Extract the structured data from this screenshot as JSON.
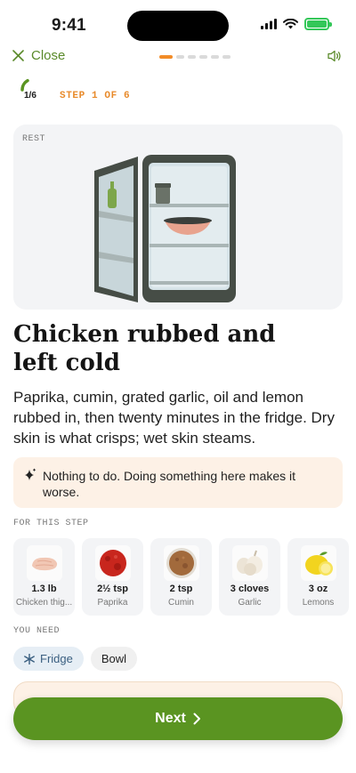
{
  "status": {
    "time": "9:41"
  },
  "nav": {
    "close_label": "Close",
    "dots_total": 6,
    "dots_active": 1
  },
  "step": {
    "count": "1/6",
    "label": "STEP 1 OF 6",
    "progress": 0.1667
  },
  "hero": {
    "tag": "REST",
    "illustration": "open-fridge-with-bowl"
  },
  "title_lines": [
    "Chicken rubbed and",
    "left cold"
  ],
  "description": "Paprika, cumin, grated garlic, oil and lemon rubbed in, then twenty minutes in the fridge. Dry skin is what crisps; wet skin steams.",
  "note": {
    "icon": "sparkle-icon",
    "text": "Nothing to do. Doing something here makes it worse."
  },
  "sections": {
    "ingredients": "FOR THIS STEP",
    "equipment": "YOU NEED"
  },
  "ingredients": [
    {
      "qty": "1.3 lb",
      "name": "Chicken thig...",
      "icon": "chicken-icon"
    },
    {
      "qty": "2½ tsp",
      "name": "Paprika",
      "icon": "paprika-icon"
    },
    {
      "qty": "2 tsp",
      "name": "Cumin",
      "icon": "cumin-icon"
    },
    {
      "qty": "3 cloves",
      "name": "Garlic",
      "icon": "garlic-icon"
    },
    {
      "qty": "3 oz",
      "name": "Lemons",
      "icon": "lemon-icon"
    }
  ],
  "equipment": [
    {
      "label": "Fridge",
      "icon": "snowflake-icon"
    },
    {
      "label": "Bowl"
    }
  ],
  "next_button": "Next",
  "colors": {
    "accent_green": "#5a9421",
    "accent_orange": "#f28c28",
    "note_bg": "#fdf1e6"
  }
}
